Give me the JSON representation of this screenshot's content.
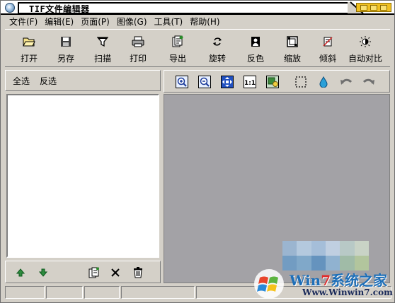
{
  "window": {
    "title": "TIF文件编辑器"
  },
  "menu": [
    {
      "label": "文件(F)"
    },
    {
      "label": "编辑(E)"
    },
    {
      "label": "页面(P)"
    },
    {
      "label": "图像(G)"
    },
    {
      "label": "工具(T)"
    },
    {
      "label": "帮助(H)"
    }
  ],
  "toolbar": [
    {
      "label": "打开",
      "icon": "folder-open-icon"
    },
    {
      "label": "另存",
      "icon": "floppy-disk-icon"
    },
    {
      "label": "扫描",
      "icon": "scanner-funnel-icon"
    },
    {
      "label": "打印",
      "icon": "printer-icon"
    },
    {
      "label": "导出",
      "icon": "export-document-icon"
    },
    {
      "label": "旋转",
      "icon": "rotate-icon"
    },
    {
      "label": "反色",
      "icon": "invert-color-icon"
    },
    {
      "label": "缩放",
      "icon": "scale-frame-icon"
    },
    {
      "label": "倾斜",
      "icon": "skew-icon"
    },
    {
      "label": "自动对比",
      "icon": "auto-contrast-icon"
    }
  ],
  "left_panel": {
    "select_all": "全选",
    "invert_select": "反选"
  },
  "left_footer_icons": [
    "move-up-icon",
    "move-down-icon",
    "copy-page-icon",
    "delete-x-icon",
    "trash-icon"
  ],
  "view_toolbar_icons": [
    "zoom-in-icon",
    "zoom-out-icon",
    "fit-window-icon",
    "actual-size-icon",
    "fit-image-icon",
    "selection-rect-icon",
    "color-drop-icon",
    "undo-icon",
    "redo-icon"
  ],
  "view_toolbar": {
    "actual_size_text": "1:1"
  },
  "watermark": {
    "brand_prefix": "Win",
    "brand_seven": "7",
    "brand_suffix": "系统之家",
    "url": "Www.Winwin7.com"
  },
  "colors": {
    "face": "#d4d0c8",
    "canvas": "#a3a2a6",
    "title_buttons": "#f0c020",
    "brand_blue": "#1e6fb8",
    "brand_red": "#e02b2b"
  }
}
